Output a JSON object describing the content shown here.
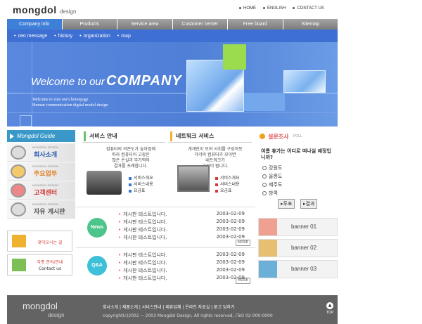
{
  "header": {
    "logo_main": "mongdol",
    "logo_sub": "design",
    "top_links": [
      "HOME",
      "ENGLISH",
      "CONTACT US"
    ]
  },
  "nav": {
    "tabs": [
      "Company info",
      "Products",
      "Service area",
      "Customer center",
      "Free board",
      "Sitemap"
    ],
    "active": "Company info"
  },
  "subnav": [
    "ceo message",
    "history",
    "organization",
    "map"
  ],
  "hero": {
    "welcome_line": "Welcome to our",
    "welcome_strong": "COMPANY",
    "sub1": "Welcome to visit our's homepage",
    "sub2": "Human communication digital  modol design"
  },
  "guide": {
    "title": "Mongdol Guide",
    "items": [
      {
        "small": "MONGDOL DESIGN",
        "label": "회사소개"
      },
      {
        "small": "MONGDOL DESIGN",
        "label": "주요업무"
      },
      {
        "small": "MONGDOL DESIGN",
        "label": "고객센터"
      },
      {
        "small": "MONGDOL DESIGN",
        "label": "자유 게시판"
      }
    ],
    "boxes": [
      {
        "label": "찾아오시는 길"
      },
      {
        "label1": "각종 문의/안내",
        "label2": "Contact us"
      }
    ]
  },
  "services": [
    {
      "title": "서비스 안내",
      "desc": [
        "컴퓨터의 의존도가 높아짐에",
        "따라 컴퓨터의 고장은",
        "많은 손실과 무기력의",
        "결과를 초래합니다."
      ],
      "links": [
        "서비스개요",
        "서비스내용",
        "요금표"
      ]
    },
    {
      "title": "네트워크 서비스",
      "desc": [
        "개개인이 모여 사회를 구성하듯",
        "각각의 컴퓨터가 모이면",
        "네트워크가",
        "구성이 됩니다."
      ],
      "links": [
        "서비스개요",
        "서비스내용",
        "요금표"
      ]
    }
  ],
  "boards": [
    {
      "name": "News",
      "rows": [
        {
          "title": "게시판 테스트입니다.",
          "date": "2003-02-09"
        },
        {
          "title": "게시판 테스트입니다.",
          "date": "2003-02-09"
        },
        {
          "title": "게시판 테스트입니다.",
          "date": "2003-02-09"
        },
        {
          "title": "게시판 테스트입니다.",
          "date": "2003-02-09"
        }
      ],
      "more": "MORE"
    },
    {
      "name": "Q&A",
      "rows": [
        {
          "title": "게시판 테스트입니다.",
          "date": "2003-02-09"
        },
        {
          "title": "게시판 테스트입니다.",
          "date": "2003-02-09"
        },
        {
          "title": "게시판 테스트입니다.",
          "date": "2003-02-09"
        },
        {
          "title": "게시판 테스트입니다.",
          "date": "2003-02-09"
        }
      ],
      "more": "MORE"
    }
  ],
  "poll": {
    "title": "설문조사",
    "title_sub": "POLL",
    "question": "여름 휴가는 어디로 떠나실 예정입니까?",
    "options": [
      "강원도",
      "울릉도",
      "제주도",
      "방콕"
    ],
    "vote_label": "투표",
    "result_label": "결과"
  },
  "banners": [
    "banner 01",
    "banner 02",
    "banner 03"
  ],
  "footer": {
    "logo_main": "mongdol",
    "logo_sub": "design",
    "links": "회사소개  |  제품소개  |  서비스안내  |  제휴업체  |  온라인 자료실  |  묻고 답하기",
    "copyright": "copyright(c)2002 ~ 2003  Mongdol Design,  All rights reserved, (Tel) 02-000-0000",
    "top_label": "TOP"
  },
  "colors": {
    "nav_active": "#3e7fd8",
    "hero_blue": "#4f7fd6",
    "accent_green": "#9bdc4e",
    "news_green": "#4cc48a",
    "qa_cyan": "#3ec0d8",
    "footer_gray": "#636363"
  }
}
